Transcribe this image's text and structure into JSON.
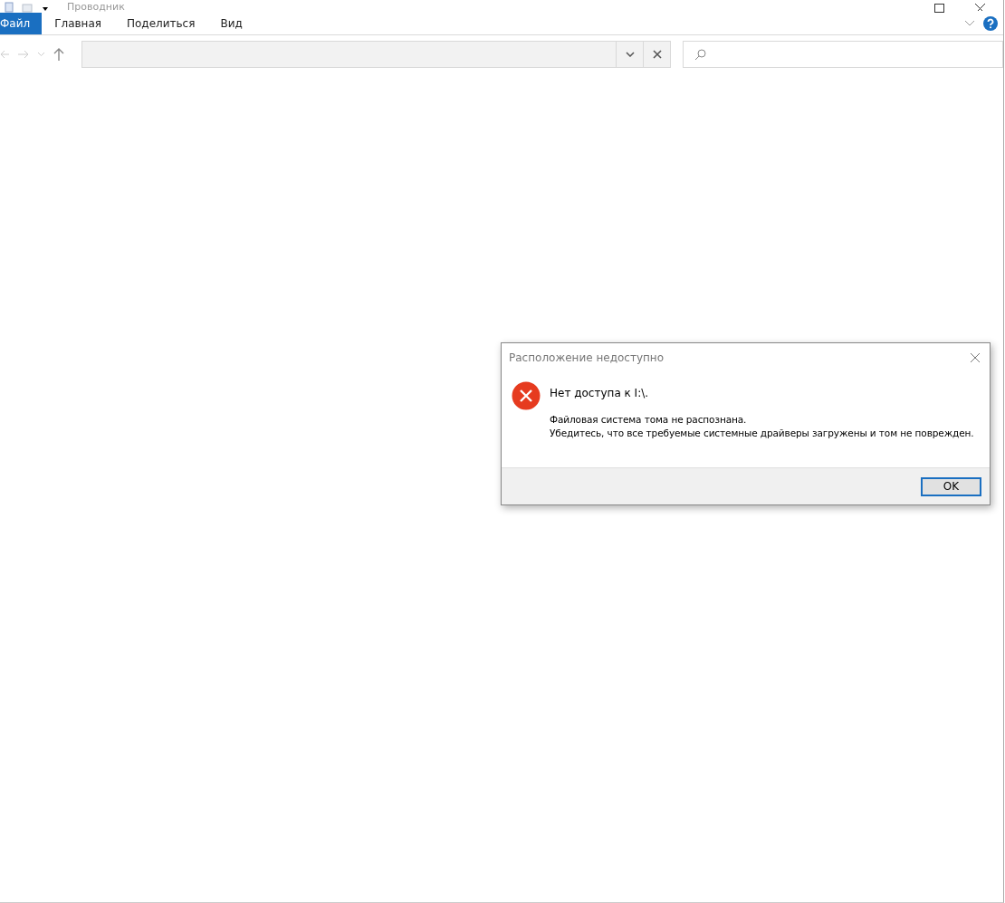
{
  "window": {
    "title": "Проводник"
  },
  "ribbon_tabs": [
    {
      "label": "Файл",
      "selected": true
    },
    {
      "label": "Главная",
      "selected": false
    },
    {
      "label": "Поделиться",
      "selected": false
    },
    {
      "label": "Вид",
      "selected": false
    }
  ],
  "dialog": {
    "title": "Расположение недоступно",
    "heading": "Нет доступа к I:\\.",
    "message_lines": [
      "Файловая система тома не распознана.",
      "Убедитесь, что все требуемые системные драйверы загружены и том не поврежден."
    ],
    "buttons": [
      "OK"
    ]
  }
}
